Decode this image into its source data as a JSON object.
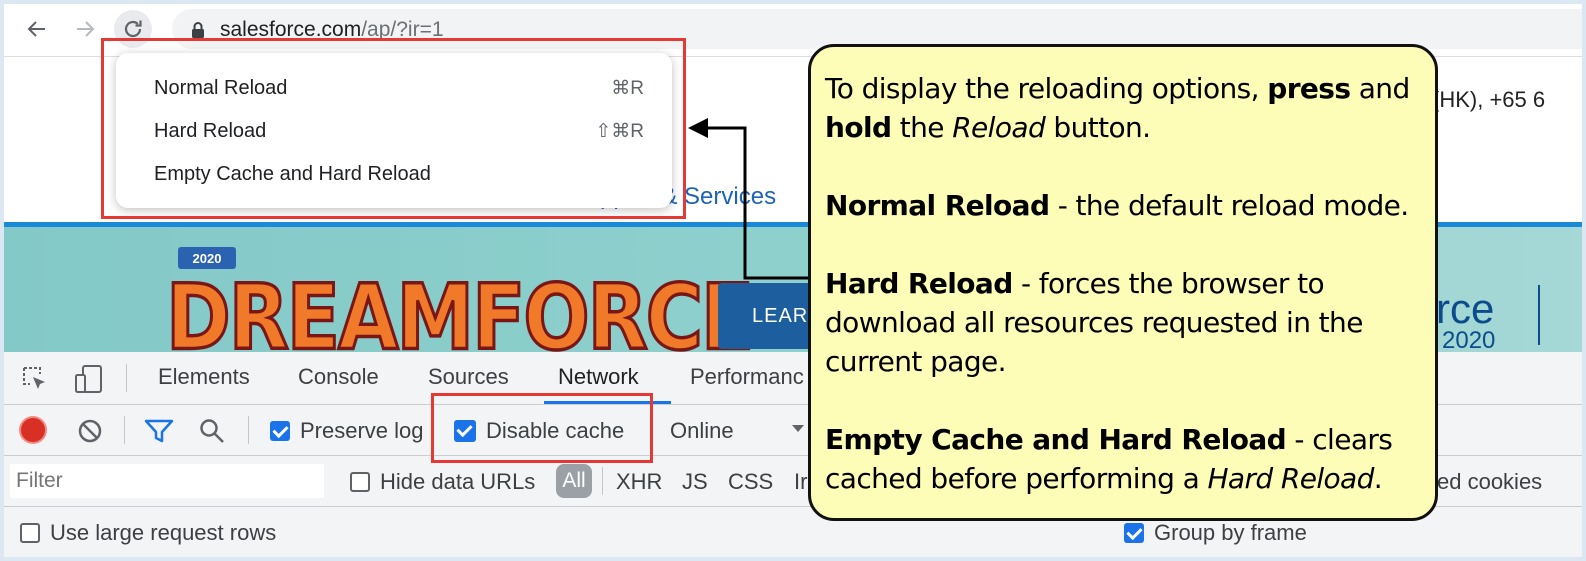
{
  "browser": {
    "url_domain": "salesforce.com",
    "url_path": "/ap/?ir=1",
    "reload_menu": [
      {
        "label": "Normal Reload",
        "shortcut": "⌘R"
      },
      {
        "label": "Hard Reload",
        "shortcut": "⇧⌘R"
      },
      {
        "label": "Empty Cache and Hard Reload",
        "shortcut": ""
      }
    ]
  },
  "page": {
    "phone_fragment": "(HK), +65 6",
    "support_link_fragment": "pport & Services",
    "banner": {
      "year_badge": "2020",
      "logo_text": "DREAMFORCE",
      "learn_button": "LEAR",
      "right_brand": "rce",
      "right_year": "2020"
    }
  },
  "devtools": {
    "tabs": [
      "Elements",
      "Console",
      "Sources",
      "Network",
      "Performanc"
    ],
    "active_tab": "Network",
    "toolbar": {
      "preserve_log": {
        "label": "Preserve log",
        "checked": true
      },
      "disable_cache": {
        "label": "Disable cache",
        "checked": true
      },
      "throttle": "Online"
    },
    "filter": {
      "placeholder": "Filter",
      "hide_data_urls": {
        "label": "Hide data URLs",
        "checked": false
      },
      "all_chip": "All",
      "type_filters": [
        "XHR",
        "JS",
        "CSS",
        "Ir"
      ],
      "blocked_cookies": "ked cookies"
    },
    "bottom": {
      "large_rows": {
        "label": "Use large request rows",
        "checked": false
      },
      "group_by_frame": {
        "label": "Group by frame",
        "checked": true
      }
    }
  },
  "callout": {
    "p1": {
      "t1": "To display the reloading options, ",
      "b1": "press",
      "t2": " and ",
      "b2": "hold",
      "t3": " the ",
      "i1": "Reload",
      "t4": " button."
    },
    "p2": {
      "b": "Normal Reload",
      "t": " - the default reload mode."
    },
    "p3": {
      "b": "Hard Reload",
      "t": " - forces the browser to download all resources requested in the current page."
    },
    "p4": {
      "b": "Empty Cache and Hard Reload",
      "t": " - clears cached before performing a ",
      "i": "Hard Reload",
      "t2": "."
    }
  },
  "colors": {
    "highlight": "#e53935",
    "callout_bg": "#fdfdb8",
    "devtools_accent": "#1a73e8",
    "record": "#d93025"
  }
}
